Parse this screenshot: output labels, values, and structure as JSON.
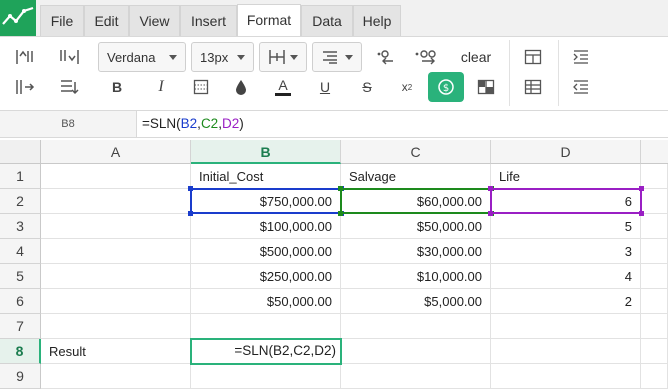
{
  "menu": {
    "items": [
      "File",
      "Edit",
      "View",
      "Insert",
      "Format",
      "Data",
      "Help"
    ],
    "active": "Format"
  },
  "toolbar": {
    "font_family": "Verdana",
    "font_size": "13px",
    "clear_label": "clear",
    "colors": {
      "accent": "#2ab27b",
      "logo": "#1fa35a"
    }
  },
  "formula_bar": {
    "cell_ref": "B8",
    "parts": [
      {
        "text": "=SLN(",
        "color": "#222222"
      },
      {
        "text": "B2",
        "color": "#1a3ccc"
      },
      {
        "text": ",",
        "color": "#222222"
      },
      {
        "text": "C2",
        "color": "#1d8a1d"
      },
      {
        "text": ",",
        "color": "#222222"
      },
      {
        "text": "D2",
        "color": "#9a1fc4"
      },
      {
        "text": ")",
        "color": "#222222"
      }
    ]
  },
  "sheet": {
    "columns": [
      "A",
      "B",
      "C",
      "D"
    ],
    "rows": [
      "1",
      "2",
      "3",
      "4",
      "5",
      "6",
      "7",
      "8",
      "9"
    ],
    "headers": {
      "B1": "Initial_Cost",
      "C1": "Salvage",
      "D1": "Life"
    },
    "data": [
      [
        "$750,000.00",
        "$60,000.00",
        "6"
      ],
      [
        "$100,000.00",
        "$50,000.00",
        "5"
      ],
      [
        "$500,000.00",
        "$30,000.00",
        "3"
      ],
      [
        "$250,000.00",
        "$10,000.00",
        "4"
      ],
      [
        "$50,000.00",
        "$5,000.00",
        "2"
      ]
    ],
    "result_label": "Result",
    "editing_value": "=SLN(B2,C2,D2)",
    "ref_colors": {
      "B2": "#1a3ccc",
      "C2": "#1d8a1d",
      "D2": "#9a1fc4"
    }
  }
}
